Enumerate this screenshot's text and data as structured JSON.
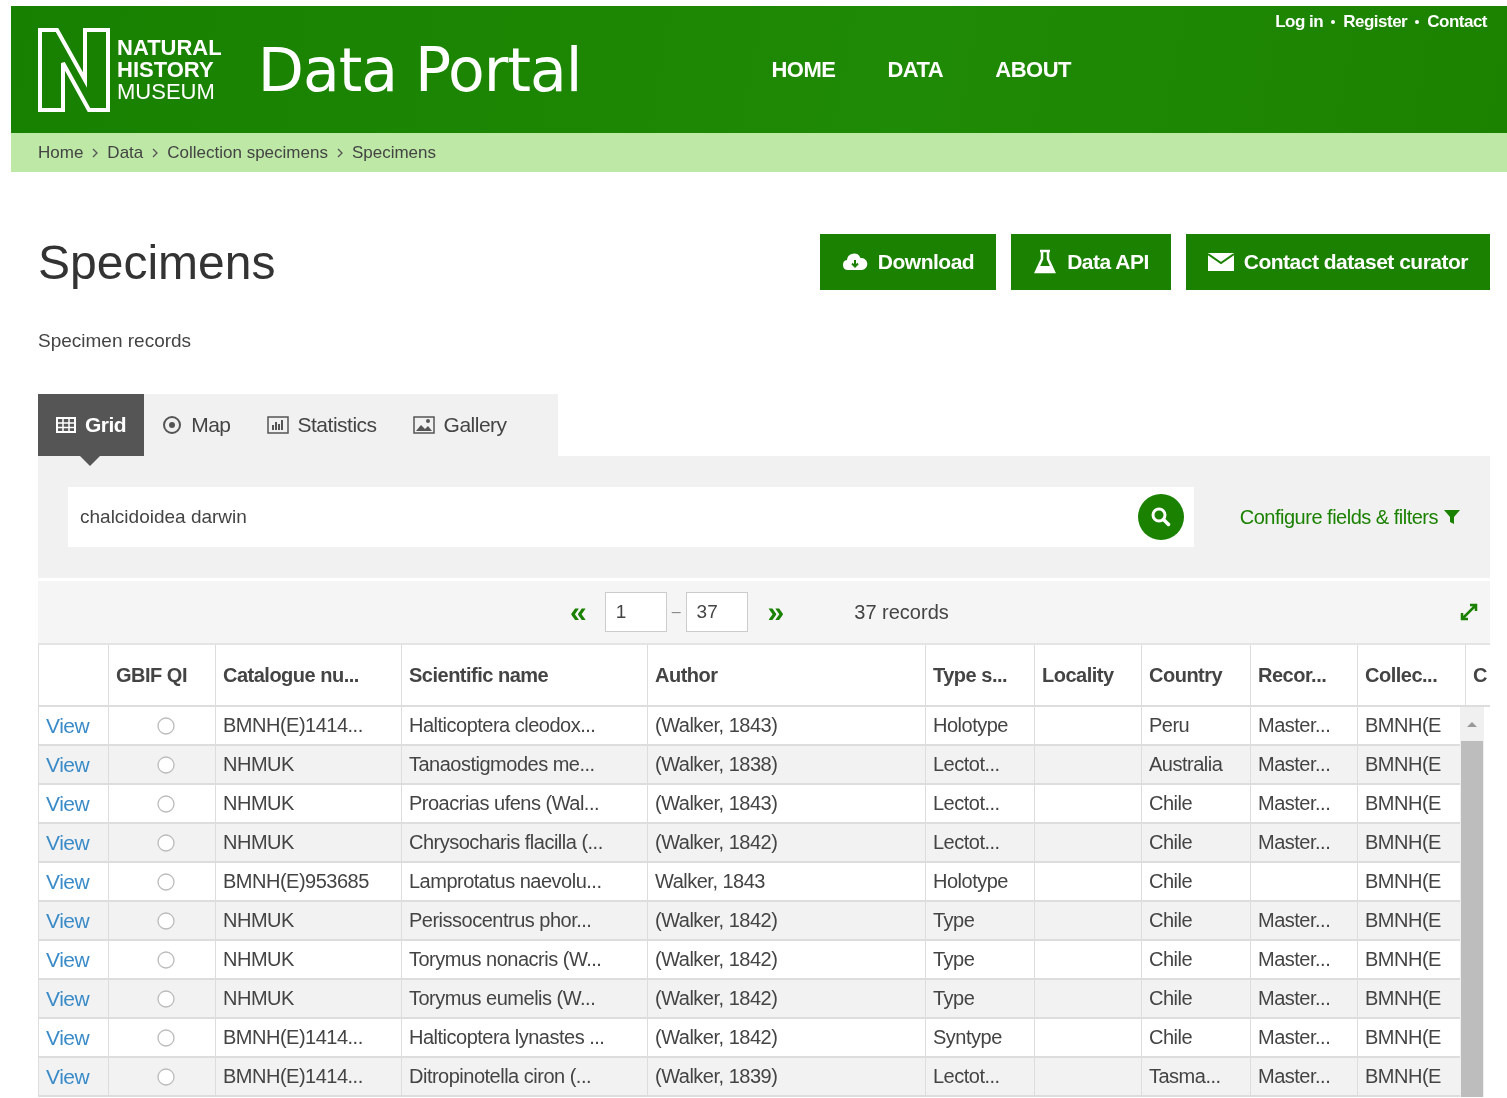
{
  "header": {
    "logo_lines": [
      "NATURAL",
      "HISTORY",
      "MUSEUM"
    ],
    "title": "Data Portal",
    "nav": [
      "HOME",
      "DATA",
      "ABOUT"
    ],
    "account_links": [
      "Log in",
      "Register",
      "Contact"
    ]
  },
  "breadcrumb": [
    "Home",
    "Data",
    "Collection specimens",
    "Specimens"
  ],
  "page": {
    "title": "Specimens",
    "subtitle": "Specimen records",
    "actions": [
      {
        "kind": "download",
        "label": "Download"
      },
      {
        "kind": "api",
        "label": "Data API"
      },
      {
        "kind": "contact",
        "label": "Contact dataset curator"
      }
    ]
  },
  "views": [
    {
      "kind": "grid",
      "label": "Grid",
      "selected": true
    },
    {
      "kind": "map",
      "label": "Map",
      "selected": false
    },
    {
      "kind": "stats",
      "label": "Statistics",
      "selected": false
    },
    {
      "kind": "gallery",
      "label": "Gallery",
      "selected": false
    }
  ],
  "search": {
    "value": "chalcidoidea darwin",
    "configure_link": "Configure fields & filters"
  },
  "pager": {
    "first": "«",
    "from": "1",
    "separator": "–",
    "to": "37",
    "last": "»",
    "count": "37 records"
  },
  "table": {
    "columns": [
      "",
      "GBIF QI",
      "Catalogue nu...",
      "Scientific name",
      "Author",
      "Type s...",
      "Locality",
      "Country",
      "Recor...",
      "Collec...",
      "C"
    ],
    "rows": [
      [
        "View",
        "",
        "BMNH(E)1414...",
        "Halticoptera cleodox...",
        "(Walker, 1843)",
        "Holotype",
        "",
        "Peru",
        "Master...",
        "BMNH(E"
      ],
      [
        "View",
        "",
        "NHMUK",
        "Tanaostigmodes me...",
        "(Walker, 1838)",
        "Lectot...",
        "",
        "Australia",
        "Master...",
        "BMNH(E"
      ],
      [
        "View",
        "",
        "NHMUK",
        "Proacrias ufens (Wal...",
        "(Walker, 1843)",
        "Lectot...",
        "",
        "Chile",
        "Master...",
        "BMNH(E"
      ],
      [
        "View",
        "",
        "NHMUK",
        "Chrysocharis flacilla (...",
        "(Walker, 1842)",
        "Lectot...",
        "",
        "Chile",
        "Master...",
        "BMNH(E"
      ],
      [
        "View",
        "",
        "BMNH(E)953685",
        "Lamprotatus naevolu...",
        "Walker, 1843",
        "Holotype",
        "",
        "Chile",
        "",
        "BMNH(E"
      ],
      [
        "View",
        "",
        "NHMUK",
        "Perissocentrus phor...",
        "(Walker, 1842)",
        "Type",
        "",
        "Chile",
        "Master...",
        "BMNH(E"
      ],
      [
        "View",
        "",
        "NHMUK",
        "Torymus nonacris (W...",
        "(Walker, 1842)",
        "Type",
        "",
        "Chile",
        "Master...",
        "BMNH(E"
      ],
      [
        "View",
        "",
        "NHMUK",
        "Torymus eumelis (W...",
        "(Walker, 1842)",
        "Type",
        "",
        "Chile",
        "Master...",
        "BMNH(E"
      ],
      [
        "View",
        "",
        "BMNH(E)1414...",
        "Halticoptera lynastes ...",
        "(Walker, 1842)",
        "Syntype",
        "",
        "Chile",
        "Master...",
        "BMNH(E"
      ],
      [
        "View",
        "",
        "BMNH(E)1414...",
        "Ditropinotella ciron (...",
        "(Walker, 1839)",
        "Lectot...",
        "",
        "Tasma...",
        "Master...",
        "BMNH(E"
      ]
    ]
  }
}
